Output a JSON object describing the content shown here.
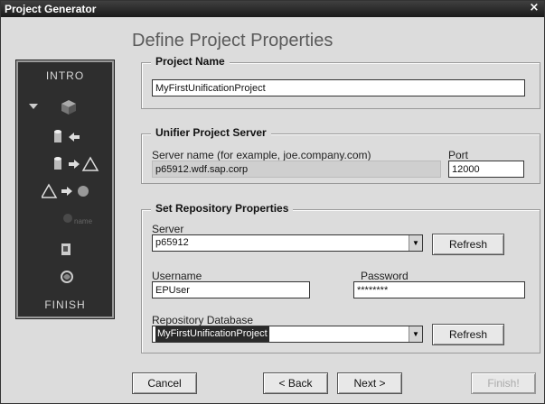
{
  "window": {
    "title": "Project Generator",
    "close_glyph": "×"
  },
  "heading": "Define Project Properties",
  "steps": {
    "intro": "INTRO",
    "finish": "FINISH",
    "disabled_step_label": "name"
  },
  "project_name": {
    "group_title": "Project Name",
    "value": "MyFirstUnificationProject"
  },
  "server": {
    "group_title": "Unifier Project Server",
    "server_label": "Server name (for example, joe.company.com)",
    "server_value": "p65912.wdf.sap.corp",
    "port_label": "Port",
    "port_value": "12000"
  },
  "repository": {
    "group_title": "Set Repository Properties",
    "server_label": "Server",
    "server_value": "p65912",
    "refresh_label": "Refresh",
    "username_label": "Username",
    "username_value": "EPUser",
    "password_label": "Password",
    "password_value": "********",
    "database_label": "Repository Database",
    "database_value": "MyFirstUnificationProject",
    "refresh2_label": "Refresh"
  },
  "footer": {
    "cancel": "Cancel",
    "back": "< Back",
    "next": "Next >",
    "finish": "Finish!"
  },
  "icons": {
    "cube": "cube-icon",
    "arrow": "arrow-left-icon"
  }
}
